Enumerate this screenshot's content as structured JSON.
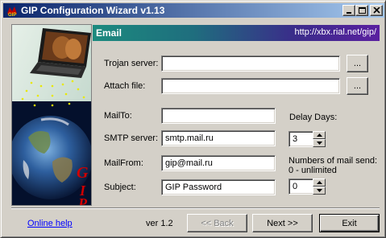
{
  "window": {
    "title": "GIP Configuration Wizard v1.13"
  },
  "header": {
    "title": "Email",
    "url": "http://xbx.rial.net/gip/"
  },
  "side_image": {
    "logo_text": "GIP"
  },
  "form": {
    "trojan_server": {
      "label": "Trojan server:",
      "value": "",
      "browse_label": "..."
    },
    "attach_file": {
      "label": "Attach file:",
      "value": "",
      "browse_label": "..."
    },
    "mail_to": {
      "label": "MailTo:",
      "value": ""
    },
    "smtp_server": {
      "label": "SMTP server:",
      "value": "smtp.mail.ru"
    },
    "mail_from": {
      "label": "MailFrom:",
      "value": "gip@mail.ru"
    },
    "subject": {
      "label": "Subject:",
      "value": "GIP Password"
    },
    "delay_days": {
      "label": "Delay Days:",
      "value": "3"
    },
    "mail_count": {
      "label_line1": "Numbers of mail send:",
      "label_line2": "0 - unlimited",
      "value": "0"
    }
  },
  "footer": {
    "online_help": "Online help",
    "version": "ver 1.2",
    "back_label": "<< Back",
    "next_label": "Next >>",
    "exit_label": "Exit"
  }
}
